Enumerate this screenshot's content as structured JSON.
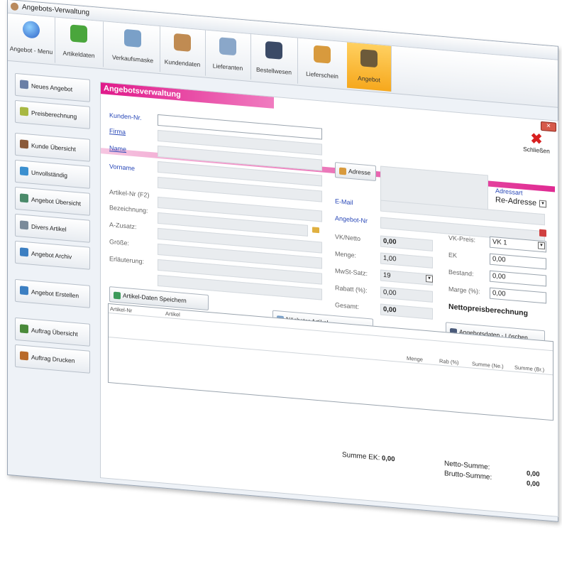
{
  "window": {
    "title": "Angebots-Verwaltung"
  },
  "toolbar": {
    "items": [
      {
        "label": "Angebot - Menu",
        "icon": "windows-orb-icon",
        "color": "#2f64c8"
      },
      {
        "label": "Artikeldaten",
        "icon": "cubes-icon",
        "color": "#4aa63c"
      },
      {
        "label": "Verkaufsmaske",
        "icon": "register-icon",
        "color": "#7aa0c8"
      },
      {
        "label": "Kundendaten",
        "icon": "people-icon",
        "color": "#c08b52"
      },
      {
        "label": "Lieferanten",
        "icon": "handshake-icon",
        "color": "#8aa7c9"
      },
      {
        "label": "Bestellwesen",
        "icon": "clipboard-icon",
        "color": "#3b4a66"
      },
      {
        "label": "Lieferschein",
        "icon": "boxes-icon",
        "color": "#d89a3d"
      },
      {
        "label": "Angebot",
        "icon": "offer-icon",
        "color": "#6c5a3a"
      }
    ]
  },
  "sidebar": {
    "items": [
      {
        "label": "Neues Angebot",
        "color": "#6a7fa6"
      },
      {
        "label": "Preisberechnung",
        "color": "#a8b842"
      },
      {
        "label": "Kunde Übersicht",
        "color": "#8a5a3a"
      },
      {
        "label": "Unvollständig",
        "color": "#3b8fcf"
      },
      {
        "label": "Angebot Übersicht",
        "color": "#4a8a6a"
      },
      {
        "label": "Divers Artikel",
        "color": "#7a8a9a"
      },
      {
        "label": "Angebot Archiv",
        "color": "#3c7fc2"
      },
      {
        "label": "Angebot Erstellen",
        "color": "#3c7fc2"
      },
      {
        "label": "Auftrag Übersicht",
        "color": "#4a8a3a"
      },
      {
        "label": "Auftrag Drucken",
        "color": "#b86a2a"
      }
    ]
  },
  "panel": {
    "title": "Angebotsverwaltung",
    "close_label": "Schließen",
    "close_box": "✕",
    "labels": {
      "kunden_nr": "Kunden-Nr.",
      "firma": "Firma",
      "name": "Name",
      "vorname": "Vorname",
      "artikel_nr": "Artikel-Nr (F2)",
      "bezeichnung": "Bezeichnung:",
      "a_zusatz": "A-Zusatz:",
      "groesse": "Größe:",
      "erlaeuterung": "Erläuterung:",
      "email": "E-Mail",
      "angebot_nr": "Angebot-Nr",
      "adressart": "Adressart",
      "vk_netto": "VK/Netto",
      "menge": "Menge:",
      "mwst": "MwSt-Satz:",
      "rabatt": "Rabatt (%):",
      "gesamt": "Gesamt:",
      "vk_preis": "VK-Preis:",
      "ek": "EK",
      "bestand": "Bestand:",
      "marge": "Marge (%):",
      "netto_berechnung": "Nettopreisberechnung",
      "summe_ek": "Summe EK:",
      "netto_summe": "Netto-Summe:",
      "brutto_summe": "Brutto-Summe:"
    },
    "values": {
      "adressart": "Re-Adresse",
      "vk_netto": "0,00",
      "menge": "1,00",
      "mwst": "19",
      "rabatt": "0,00",
      "gesamt": "0,00",
      "vk_preis": "VK 1",
      "ek": "0,00",
      "bestand": "0,00",
      "marge": "0,00",
      "summe_ek": "0,00",
      "netto_summe": "0,00",
      "brutto_summe": "0,00"
    },
    "buttons": {
      "adresse": "Adresse",
      "artikel_speichern": "Artikel-Daten Speichern",
      "naechster_artikel": "Nächster Artikel",
      "loeschen": "Angebotsdaten - Löschen"
    },
    "grid_left": {
      "columns": [
        "Artikel-Nr",
        "Artikel"
      ]
    },
    "grid_right": {
      "columns": [
        "Menge",
        "Rab (%)",
        "Summe (Ne.)",
        "Summe (Br.)"
      ]
    }
  }
}
